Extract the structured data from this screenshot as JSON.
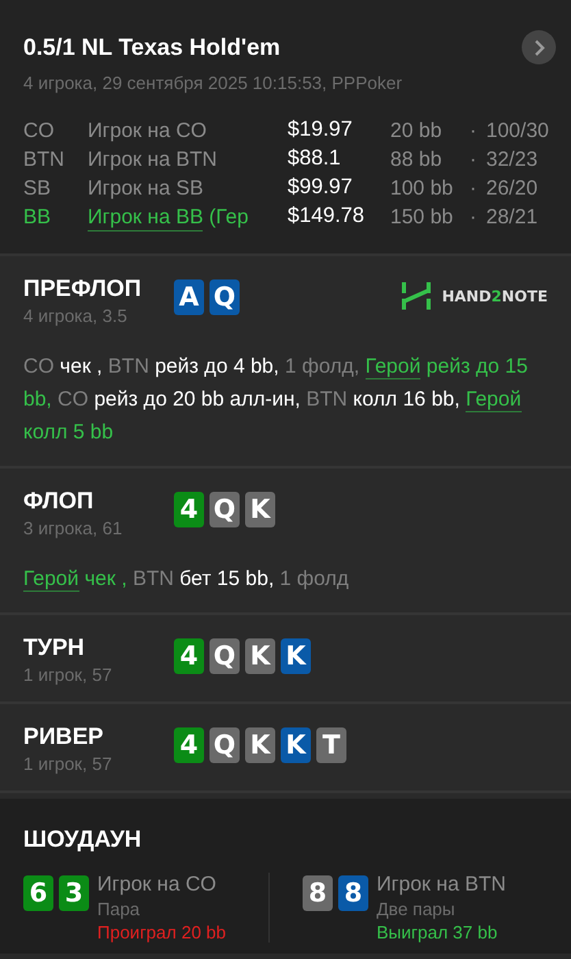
{
  "header": {
    "title": "0.5/1 NL Texas Hold'em",
    "subtitle": "4 игрока, 29 сентября 2025 10:15:53, PPPoker",
    "players": [
      {
        "position": "CO",
        "name": "Игрок на CO",
        "stack": "$19.97",
        "bb": "20 bb",
        "separator": "·",
        "stats": "100/30",
        "hero": false
      },
      {
        "position": "BTN",
        "name": "Игрок на BTN",
        "stack": "$88.1",
        "bb": "88 bb",
        "separator": "·",
        "stats": "32/23",
        "hero": false
      },
      {
        "position": "SB",
        "name": "Игрок на SB",
        "stack": "$99.97",
        "bb": "100 bb",
        "separator": "·",
        "stats": "26/20",
        "hero": false
      },
      {
        "position": "BB",
        "name": "Игрок на BB",
        "note": "(Гер",
        "stack": "$149.78",
        "bb": "150 bb",
        "separator": "·",
        "stats": "28/21",
        "hero": true
      }
    ]
  },
  "logo": [
    "HAND",
    "2",
    "NOTE"
  ],
  "streets": [
    {
      "name": "ПРЕФЛОП",
      "info": "4 игрока, 3.5",
      "cards": [
        {
          "rank": "A",
          "color": "#0a5aa8"
        },
        {
          "rank": "Q",
          "color": "#0a5aa8"
        }
      ],
      "actions": [
        {
          "text": "CO",
          "kind": "actor"
        },
        {
          "text": "чек ,",
          "kind": "action"
        },
        {
          "text": "BTN",
          "kind": "actor"
        },
        {
          "text": "рейз до 4 bb,",
          "kind": "action"
        },
        {
          "text": "1 фолд,",
          "kind": "fold"
        },
        {
          "text": "Герой",
          "kind": "hero"
        },
        {
          "text": "рейз до 15 bb,",
          "kind": "hero_action"
        },
        {
          "text": "CO",
          "kind": "actor"
        },
        {
          "text": "рейз до 20 bb алл-ин,",
          "kind": "action"
        },
        {
          "text": "BTN",
          "kind": "actor"
        },
        {
          "text": "колл 16 bb,",
          "kind": "action"
        },
        {
          "text": "Герой",
          "kind": "hero"
        },
        {
          "text": "колл 5 bb",
          "kind": "hero_action"
        }
      ]
    },
    {
      "name": "ФЛОП",
      "info": "3 игрока, 61",
      "cards": [
        {
          "rank": "4",
          "color": "#0b8c16"
        },
        {
          "rank": "Q",
          "color": "#6a6a6a"
        },
        {
          "rank": "K",
          "color": "#6a6a6a"
        }
      ],
      "actions": [
        {
          "text": "Герой",
          "kind": "hero"
        },
        {
          "text": "чек ,",
          "kind": "hero_action"
        },
        {
          "text": "BTN",
          "kind": "actor"
        },
        {
          "text": "бет 15 bb,",
          "kind": "action"
        },
        {
          "text": "1 фолд",
          "kind": "fold"
        }
      ]
    },
    {
      "name": "ТУРН",
      "info": "1 игрок, 57",
      "cards": [
        {
          "rank": "4",
          "color": "#0b8c16"
        },
        {
          "rank": "Q",
          "color": "#6a6a6a"
        },
        {
          "rank": "K",
          "color": "#6a6a6a"
        },
        {
          "rank": "K",
          "color": "#0a5aa8"
        }
      ]
    },
    {
      "name": "РИВЕР",
      "info": "1 игрок, 57",
      "cards": [
        {
          "rank": "4",
          "color": "#0b8c16"
        },
        {
          "rank": "Q",
          "color": "#6a6a6a"
        },
        {
          "rank": "K",
          "color": "#6a6a6a"
        },
        {
          "rank": "K",
          "color": "#0a5aa8"
        },
        {
          "rank": "T",
          "color": "#6a6a6a"
        }
      ]
    }
  ],
  "showdown": {
    "title": "ШОУДАУН",
    "hands": [
      {
        "cards": [
          {
            "rank": "6",
            "color": "#0b8c16"
          },
          {
            "rank": "3",
            "color": "#0b8c16"
          }
        ],
        "player": "Игрок на CO",
        "combo": "Пара",
        "result": "Проиграл 20 bb",
        "won": false
      },
      {
        "cards": [
          {
            "rank": "8",
            "color": "#6a6a6a"
          },
          {
            "rank": "8",
            "color": "#0a5aa8"
          }
        ],
        "player": "Игрок на BTN",
        "combo": "Две пары",
        "result": "Выиграл 37 bb",
        "won": true
      }
    ]
  }
}
